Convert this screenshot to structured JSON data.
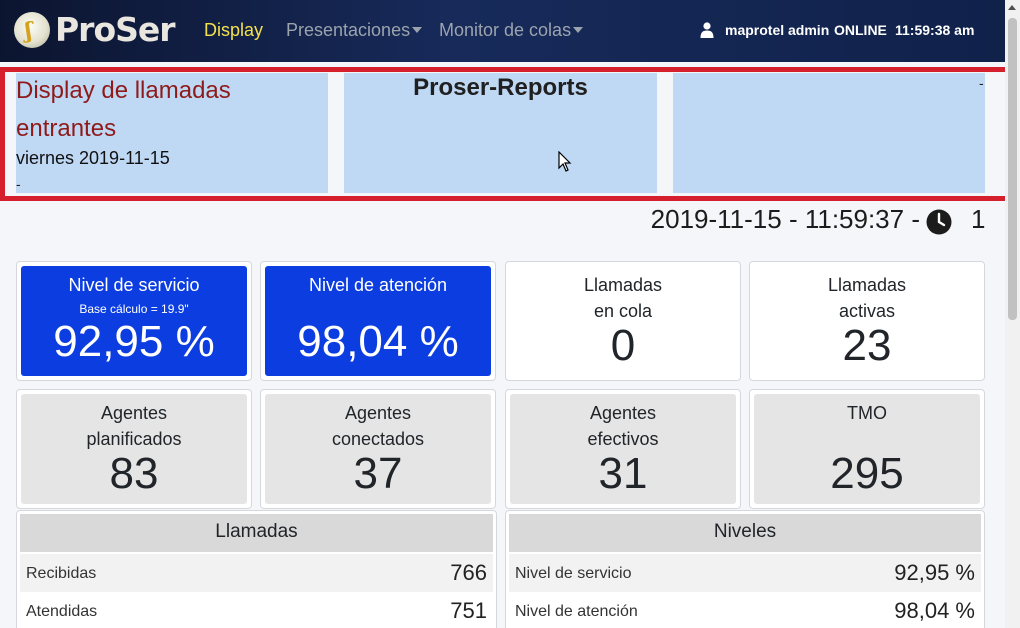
{
  "navbar": {
    "brand": "ProSer",
    "items": [
      {
        "label": "Display"
      },
      {
        "label": "Presentaciones"
      },
      {
        "label": "Monitor de colas"
      }
    ],
    "user": "maprotel admin",
    "status": "ONLINE",
    "time": "11:59:38 am"
  },
  "header": {
    "title": "Display de llamadas entrantes",
    "date": "viernes 2019-11-15",
    "left_dash": "-",
    "center_title": "Proser-Reports",
    "right_dash": "-"
  },
  "clock": {
    "datetime": "2019-11-15 - 11:59:37 -",
    "count": "1"
  },
  "cards_row1": [
    {
      "label": "Nivel de servicio",
      "sub": "Base cálculo = 19.9\"",
      "value": "92,95 %",
      "color": "#0b3de0"
    },
    {
      "label": "Nivel de atención",
      "value": "98,04 %",
      "color": "#0b3de0"
    },
    {
      "label1": "Llamadas",
      "label2": "en cola",
      "value": "0"
    },
    {
      "label1": "Llamadas",
      "label2": "activas",
      "value": "23"
    }
  ],
  "cards_row2": [
    {
      "label1": "Agentes",
      "label2": "planificados",
      "value": "83"
    },
    {
      "label1": "Agentes",
      "label2": "conectados",
      "value": "37"
    },
    {
      "label1": "Agentes",
      "label2": "efectivos",
      "value": "31"
    },
    {
      "label1": "TMO",
      "label2": "",
      "value": "295"
    }
  ],
  "llamadas": {
    "title": "Llamadas",
    "rows": [
      {
        "label": "Recibidas",
        "value": "766"
      },
      {
        "label": "Atendidas",
        "value": "751"
      }
    ]
  },
  "niveles": {
    "title": "Niveles",
    "rows": [
      {
        "label": "Nivel de servicio",
        "value": "92,95 %"
      },
      {
        "label": "Nivel de atención",
        "value": "98,04 %"
      }
    ]
  },
  "colors": {
    "accent_blue": "#0b3de0",
    "header_bg": "#bfd9f5",
    "title_red": "#8e1a1a",
    "nav_active": "#f5e04c",
    "frame_red": "#d61f2c"
  }
}
